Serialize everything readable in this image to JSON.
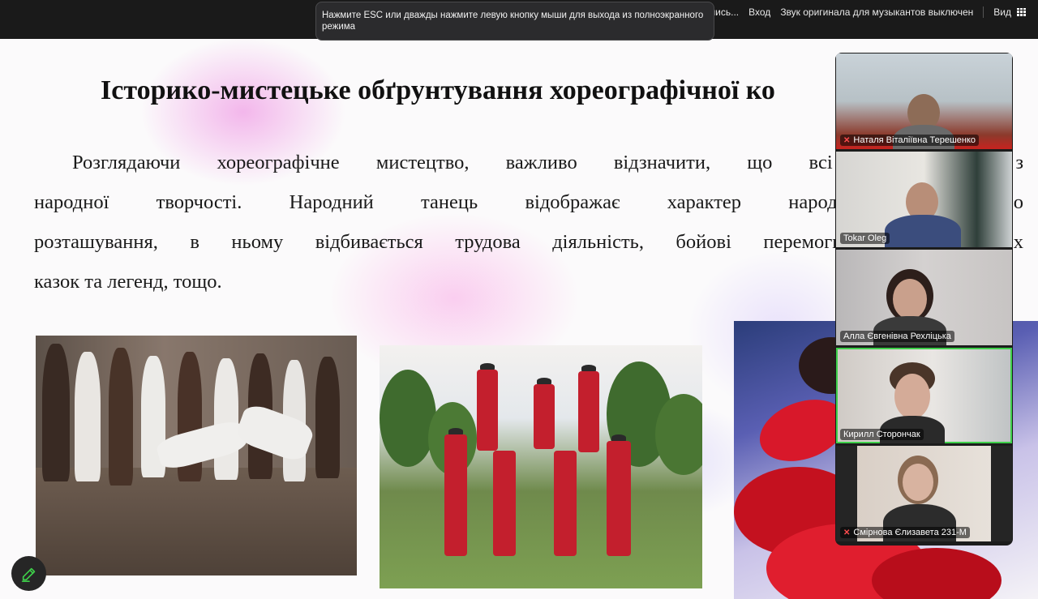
{
  "toast": {
    "message": "Нажмите ESC или дважды нажмите левую кнопку мыши для выхода из полноэкранного режима"
  },
  "toolbar": {
    "record_label": "Запись...",
    "login_label": "Вход",
    "original_sound_label": "Звук оригинала для музыкантов выключен",
    "view_label": "Вид"
  },
  "slide": {
    "title": "Історико-мистецьке обґрунтування хореографічної ко",
    "paragraph_lines": [
      "Розглядаючи хореографічне мистецтво, важливо відзначити, що всі танці бер                              з",
      "народної творчості. Народний танець відображає характер народу, особлив                              о",
      "розташування, в ньому відбивається трудова діяльність, бойові перемоги та поразк                   х",
      "казок та легенд, тощо."
    ]
  },
  "participants": [
    {
      "name": "Наталя Віталіївна Терешенко",
      "muted": true
    },
    {
      "name": "Tokar Oleg",
      "muted": false
    },
    {
      "name": "Алла Євгенівна Рехліцька",
      "muted": false
    },
    {
      "name": "Кирилл Сторончак",
      "muted": false,
      "active_speaker": true
    },
    {
      "name": "Смірнова Єлизавета 231-М",
      "muted": true
    }
  ],
  "icons": {
    "annotate": "pencil-icon",
    "view": "grid-icon",
    "mic_off": "mic-off-icon"
  },
  "colors": {
    "active_speaker": "#3ecf4a",
    "recording": "#e5484d",
    "mic_off": "#ff4d4f"
  }
}
